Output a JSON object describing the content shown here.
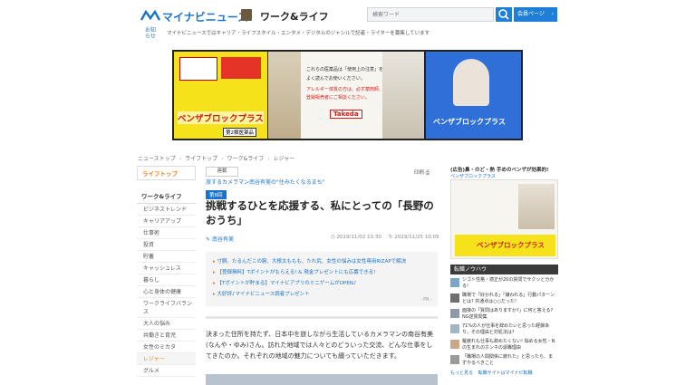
{
  "header": {
    "logo_text": "マイナビニュース",
    "category_title": "ワーク&ライフ",
    "search_placeholder": "検索ワード",
    "member_label": "会員ページ",
    "notice_label": "お知らせ",
    "notice_text": "マイナビニュースではキャリア・ライフスタイル・エンタメ・デジタルのジャンルで記者・ライターを募集しています"
  },
  "banner": {
    "product_name": "ベンザブロックプラス",
    "notice_line1": "これらの医薬品は「使用上の注意」を",
    "notice_line2": "よく読んでお使いください。",
    "notice_line3": "アレルギー体質の方は、必ず薬剤師、",
    "notice_line4": "登録販売者にご相談ください。",
    "brand": "Takeda",
    "drug_class": "第2類医薬品"
  },
  "breadcrumb": [
    "ニューストップ",
    "ライフトップ",
    "ワーク&ライフ",
    "レジャー"
  ],
  "sidebar": {
    "top_label": "ライフトップ",
    "section_label": "ワーク&ライフ",
    "items": [
      "ビジネストレンド",
      "キャリアアップ",
      "仕事術",
      "投資",
      "貯蓄",
      "キャッシュレス",
      "暮らし",
      "心と身体の健康",
      "ワークライフバランス",
      "大人の悩み",
      "共働きと育児",
      "女性のミカタ",
      "レジャー",
      "グルメ"
    ]
  },
  "article": {
    "series_tag": "連載",
    "series_title": "旅するカメラマン南谷有美の\"住みたくなるまち\"",
    "print_label": "印刷",
    "episode_tag": "第8回",
    "title": "挑戦するひとを応援する、私にとっての「長野のおうち」",
    "author": "南谷有美",
    "published": "2019/11/02 10:30",
    "updated": "2019/11/25 10:05",
    "links": [
      "寸胴、たるんだこの腕、大根太ももも、たれ尻、女性の悩みは女性専用RIZAPで解決",
      "【登録無料】Tポイントがもらえる! & 現金プレゼントにも応募できる!",
      "【Tポイントが貯まる】マイナビアプリのミニゲームがOPEN♪",
      "大好評♪マイナビニュース読者プレゼント"
    ],
    "pr_label": "- PR -",
    "lead": "決まった住所を持たず、日本中を旅しながら生活しているカメラマンの南谷有美(なんや・ゆみ)さん。訪れた地域では人々とのどういった交流、どんな仕事をしてきたのか。それぞれの地域の魅力についても綴っていただきます。"
  },
  "right_ad": {
    "caption": "(広告)鼻・のど・熱 手めのベンザが効果的!",
    "caption2": "ベンザブロックプラス",
    "product_name": "ベンザブロックプラス"
  },
  "knowhow": {
    "header": "転職ノウハウ",
    "items": [
      "シゴト性格・適正が20の質問でサクッと分かる!",
      "職場で「好かれる」「嫌われる」行動パターンとは? 共通点は○○だった!",
      "面接の「質問はありますか?」に何と答える? NG逆質問集",
      "71%の人が仕事を辞めたいと思った経験あり。その理由と対処法は?",
      "羅疲れも仕事も辞めたくない! 悩める女性・Nの生まれのホンネの退職理由",
      "「職場の人間関係に疲れた」と思ったら、まずやるべきこと"
    ],
    "more_label": "もっと見る",
    "more_link": "転職サイトはマイナビ転職"
  }
}
